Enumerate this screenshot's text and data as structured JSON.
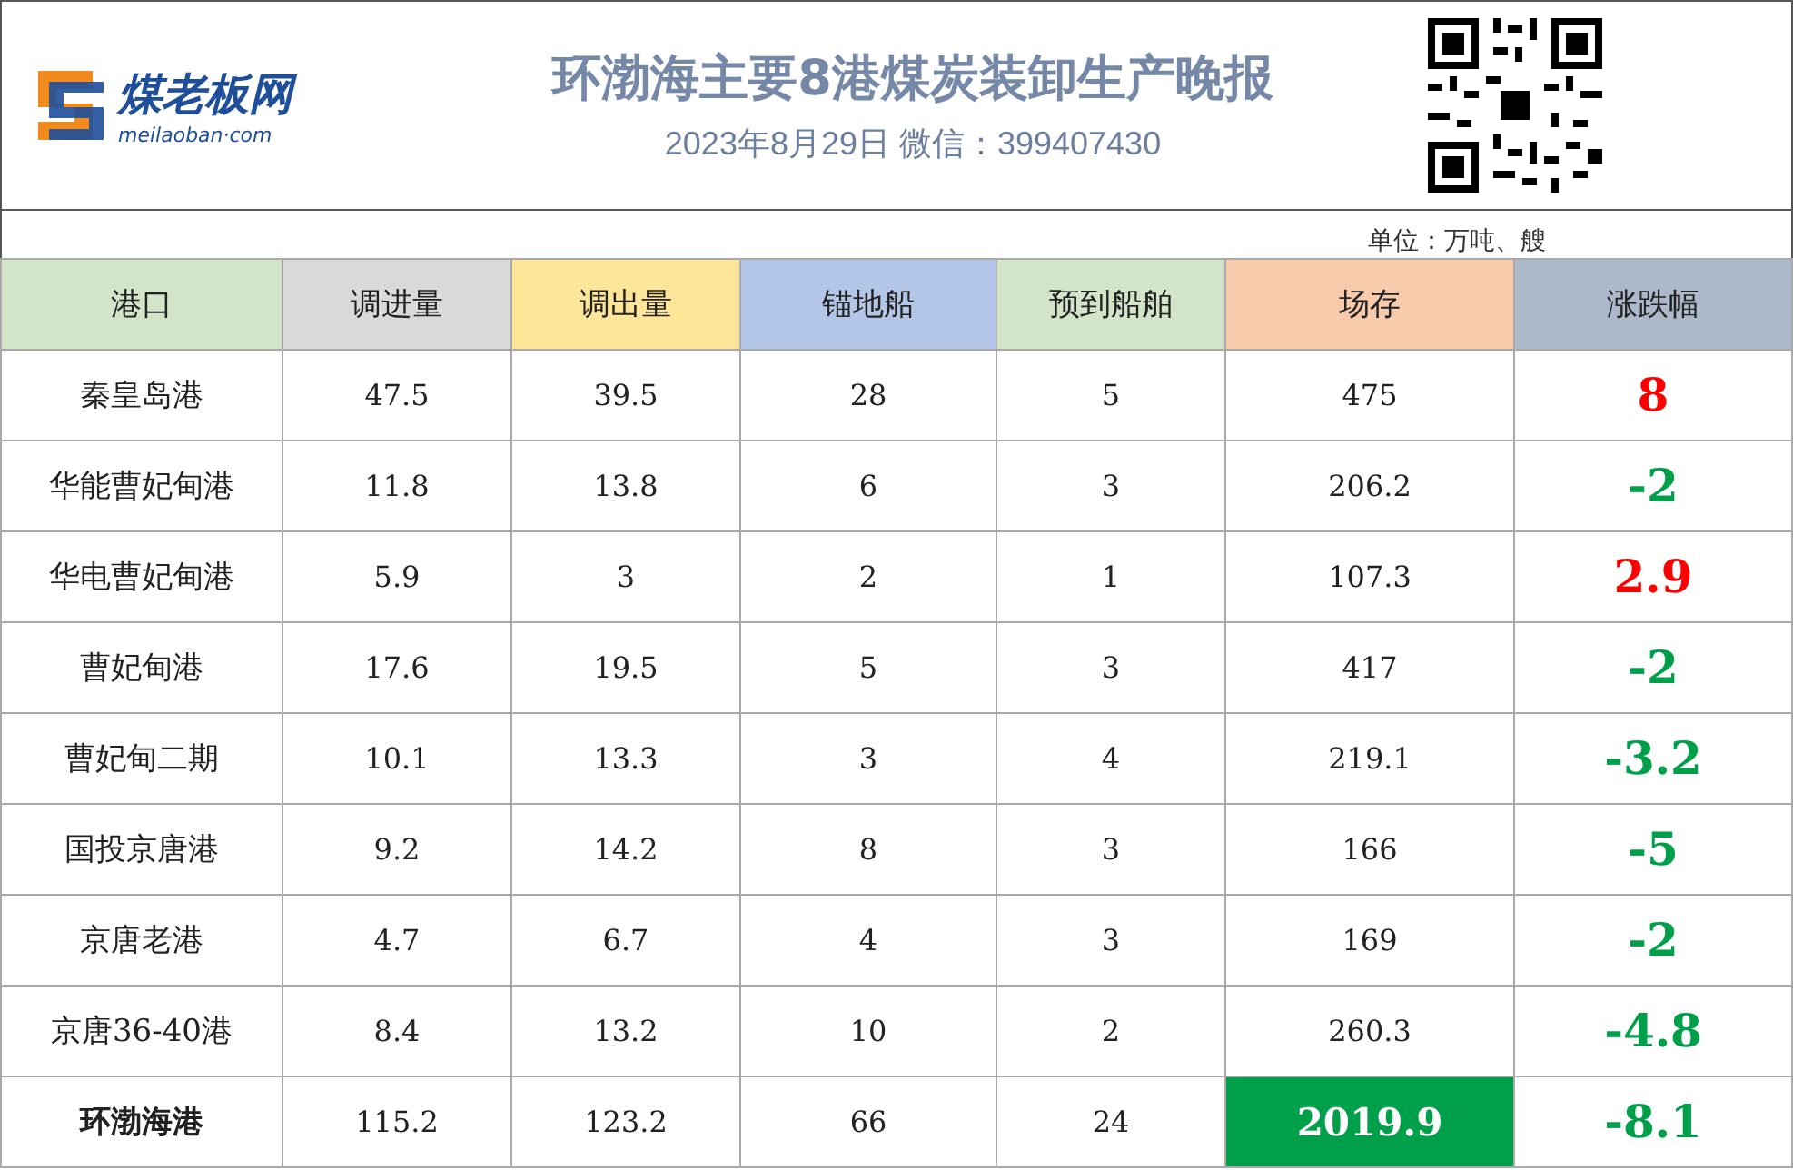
{
  "logo": {
    "name": "煤老板网",
    "domain": "meilaoban·com"
  },
  "title": "环渤海主要8港煤炭装卸生产晚报",
  "subtitle": "2023年8月29日  微信：399407430",
  "unit": "单位：万吨、艘",
  "columns": [
    {
      "label": "港口",
      "color": "#d3e5c8"
    },
    {
      "label": "调进量",
      "color": "#d9d9d9"
    },
    {
      "label": "调出量",
      "color": "#fde59a"
    },
    {
      "label": "锚地船",
      "color": "#b4c6e7"
    },
    {
      "label": "预到船舶",
      "color": "#d3e5c8"
    },
    {
      "label": "场存",
      "color": "#f8cbad"
    },
    {
      "label": "涨跌幅",
      "color": "#acb9ca"
    }
  ],
  "rows": [
    {
      "port": "秦皇岛港",
      "in": "47.5",
      "out": "39.5",
      "anchored": "28",
      "expected": "5",
      "stock": "475",
      "change": "8",
      "color": "#ff0000",
      "total": false
    },
    {
      "port": "华能曹妃甸港",
      "in": "11.8",
      "out": "13.8",
      "anchored": "6",
      "expected": "3",
      "stock": "206.2",
      "change": "-2",
      "color": "#00a04a",
      "total": false
    },
    {
      "port": "华电曹妃甸港",
      "in": "5.9",
      "out": "3",
      "anchored": "2",
      "expected": "1",
      "stock": "107.3",
      "change": "2.9",
      "color": "#ff0000",
      "total": false
    },
    {
      "port": "曹妃甸港",
      "in": "17.6",
      "out": "19.5",
      "anchored": "5",
      "expected": "3",
      "stock": "417",
      "change": "-2",
      "color": "#00a04a",
      "total": false
    },
    {
      "port": "曹妃甸二期",
      "in": "10.1",
      "out": "13.3",
      "anchored": "3",
      "expected": "4",
      "stock": "219.1",
      "change": "-3.2",
      "color": "#00a04a",
      "total": false
    },
    {
      "port": "国投京唐港",
      "in": "9.2",
      "out": "14.2",
      "anchored": "8",
      "expected": "3",
      "stock": "166",
      "change": "-5",
      "color": "#00a04a",
      "total": false
    },
    {
      "port": "京唐老港",
      "in": "4.7",
      "out": "6.7",
      "anchored": "4",
      "expected": "3",
      "stock": "169",
      "change": "-2",
      "color": "#00a04a",
      "total": false
    },
    {
      "port": "京唐36-40港",
      "in": "8.4",
      "out": "13.2",
      "anchored": "10",
      "expected": "2",
      "stock": "260.3",
      "change": "-4.8",
      "color": "#00a04a",
      "total": false
    },
    {
      "port": "环渤海港",
      "in": "115.2",
      "out": "123.2",
      "anchored": "66",
      "expected": "24",
      "stock": "2019.9",
      "change": "-8.1",
      "color": "#00a04a",
      "total": true
    }
  ]
}
